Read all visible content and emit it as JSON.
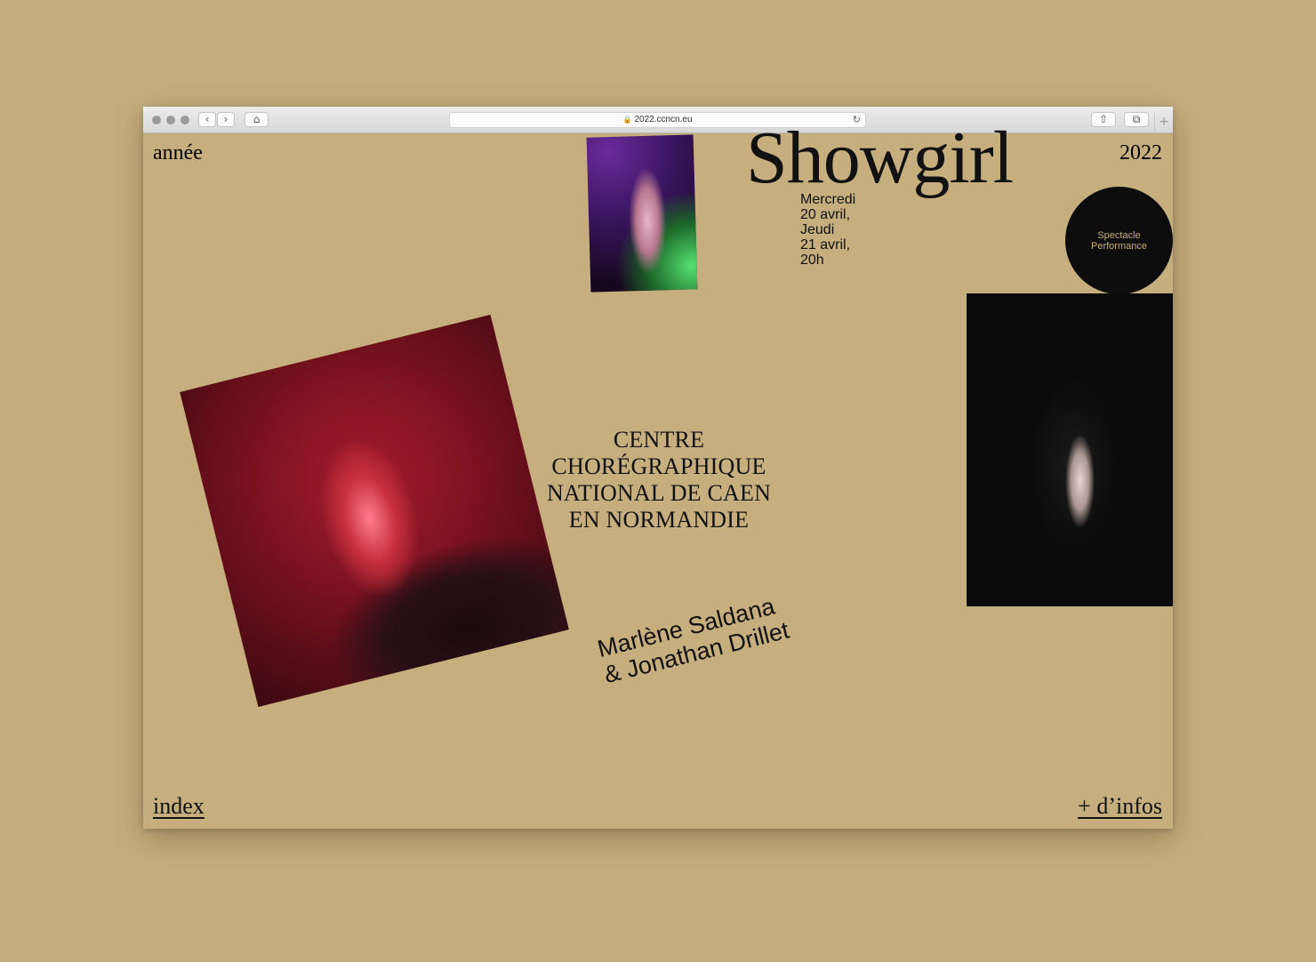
{
  "browser": {
    "url": "2022.ccncn.eu",
    "back_glyph": "‹",
    "forward_glyph": "›",
    "home_glyph": "⌂",
    "reload_glyph": "↻",
    "share_glyph": "⇧",
    "tabs_glyph": "⧉",
    "newtab_glyph": "+",
    "lock_glyph": "🔒"
  },
  "page": {
    "section_label": "année",
    "year": "2022",
    "title": "Showgirl",
    "dates": [
      "Mercredi",
      "20 avril,",
      "Jeudi",
      "21 avril,",
      "20h"
    ],
    "badge": [
      "Spectacle",
      "Performance"
    ],
    "centre": [
      "CENTRE",
      "CHORÉGRAPHIQUE",
      "NATIONAL DE CAEN",
      "EN NORMANDIE"
    ],
    "artists": [
      "Marlène Saldana",
      "& Jonathan Drillet"
    ],
    "index_link": "index",
    "infos_link": "+ d’infos"
  },
  "colors": {
    "background": "#c6ae7e",
    "text": "#111111",
    "badge_bg": "#0d0d0d",
    "badge_text": "#c9ae78"
  }
}
